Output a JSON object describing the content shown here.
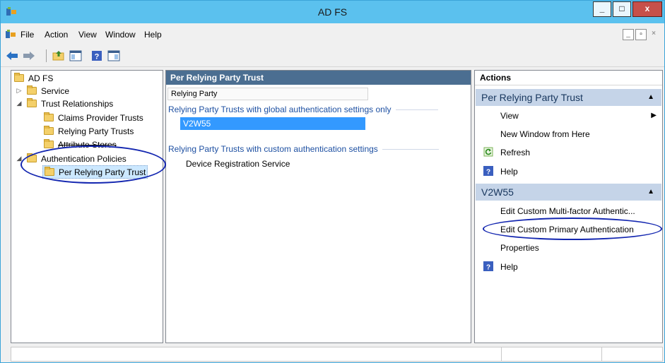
{
  "window": {
    "title": "AD FS"
  },
  "title_buttons": {
    "minimize": "_",
    "maximize": "□",
    "close": "x"
  },
  "menu": {
    "items": [
      "File",
      "Action",
      "View",
      "Window",
      "Help"
    ]
  },
  "mdi_buttons": [
    "_",
    "▫",
    "×"
  ],
  "toolbar": {
    "icons": [
      "back-arrow-icon",
      "forward-arrow-icon",
      "up-folder-icon",
      "show-hide-console-tree-icon",
      "help-icon",
      "show-hide-action-pane-icon"
    ]
  },
  "tree": {
    "root": "AD FS",
    "service": "Service",
    "trust_relationships": "Trust Relationships",
    "claims_provider_trusts": "Claims Provider Trusts",
    "relying_party_trusts": "Relying Party Trusts",
    "attribute_stores": "Attribute Stores",
    "authentication_policies": "Authentication Policies",
    "per_relying_party_trust": "Per Relying Party Trust"
  },
  "center": {
    "header": "Per Relying Party Trust",
    "column": "Relying Party",
    "group_global": "Relying Party Trusts with global authentication settings only",
    "group_global_items": [
      "V2W55"
    ],
    "group_custom": "Relying Party Trusts with custom authentication settings",
    "group_custom_items": [
      "Device Registration Service"
    ]
  },
  "actions": {
    "title": "Actions",
    "section1": {
      "label": "Per Relying Party Trust",
      "items": [
        "View",
        "New Window from Here",
        "Refresh",
        "Help"
      ]
    },
    "section2": {
      "label": "V2W55",
      "items": [
        "Edit Custom Multi-factor Authentic...",
        "Edit Custom Primary Authentication",
        "Properties",
        "Help"
      ]
    }
  },
  "colors": {
    "title_bar": "#5bc1ee",
    "pane_header": "#4b6e91",
    "selection": "#3399ff",
    "annotation": "#1326b0"
  }
}
